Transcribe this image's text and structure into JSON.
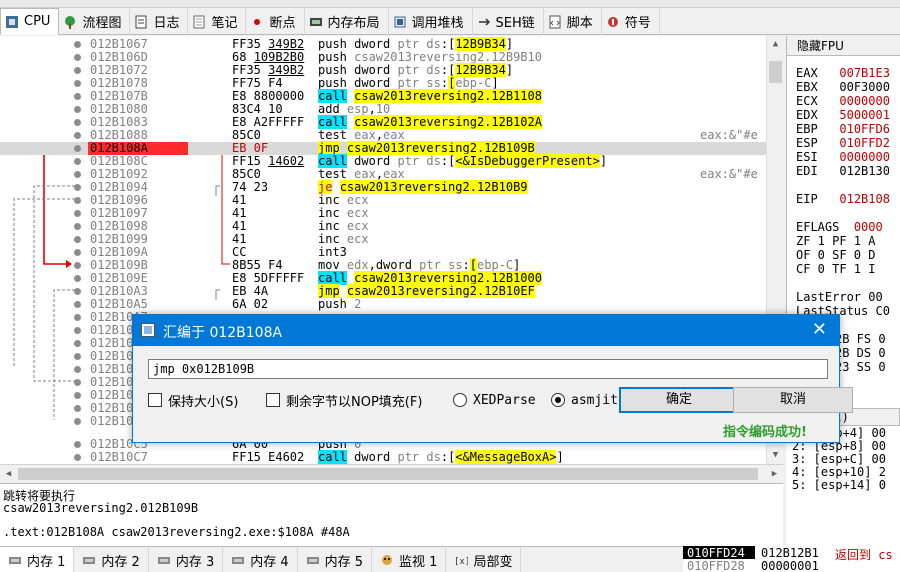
{
  "top_tabs": [
    {
      "label": "CPU",
      "icon": "cpu-icon"
    },
    {
      "label": "流程图",
      "icon": "graph-icon"
    },
    {
      "label": "日志",
      "icon": "log-icon"
    },
    {
      "label": "笔记",
      "icon": "notes-icon"
    },
    {
      "label": "断点",
      "icon": "breakpoint-icon"
    },
    {
      "label": "内存布局",
      "icon": "memory-map-icon"
    },
    {
      "label": "调用堆栈",
      "icon": "callstack-icon"
    },
    {
      "label": "SEH链",
      "icon": "seh-icon"
    },
    {
      "label": "脚本",
      "icon": "script-icon"
    },
    {
      "label": "符号",
      "icon": "symbol-icon"
    }
  ],
  "disasm": [
    {
      "addr": "012B1067",
      "b1": "FF35 ",
      "bu": "349B2",
      "ins": "push dword ptr ds:[12B9B34]",
      "cmt": ""
    },
    {
      "addr": "012B106D",
      "b1": "68 ",
      "bu": "109B2B0",
      "ins": "push csaw2013reversing2.12B9B10",
      "cmt": ""
    },
    {
      "addr": "012B1072",
      "b1": "FF35 ",
      "bu": "349B2",
      "ins": "push dword ptr ds:[12B9B34]",
      "cmt": ""
    },
    {
      "addr": "012B1078",
      "b1": "FF75 F4",
      "bu": "",
      "ins": "push dword ptr ss:[ebp-C]",
      "cmt": ""
    },
    {
      "addr": "012B107B",
      "b1": "E8 8800000",
      "bu": "",
      "ins": "call csaw2013reversing2.12B1108",
      "cmt": ""
    },
    {
      "addr": "012B1080",
      "b1": "83C4 10",
      "bu": "",
      "ins": "add esp,10",
      "cmt": ""
    },
    {
      "addr": "012B1083",
      "b1": "E8 A2FFFFF",
      "bu": "",
      "ins": "call csaw2013reversing2.12B102A",
      "cmt": ""
    },
    {
      "addr": "012B1088",
      "b1": "85C0",
      "bu": "",
      "ins": "test eax,eax",
      "cmt": "eax:&\"#e"
    },
    {
      "addr": "012B108A",
      "b1": "EB 0F",
      "bu": "",
      "ins": "jmp csaw2013reversing2.12B109B",
      "cmt": ""
    },
    {
      "addr": "012B108C",
      "b1": "FF15 ",
      "bu": "14602",
      "ins": "call dword ptr ds:[<&IsDebuggerPresent>]",
      "cmt": ""
    },
    {
      "addr": "012B1092",
      "b1": "85C0",
      "bu": "",
      "ins": "test eax,eax",
      "cmt": "eax:&\"#e"
    },
    {
      "addr": "012B1094",
      "b1": "74 23",
      "bu": "",
      "ins": "je csaw2013reversing2.12B10B9",
      "cmt": ""
    },
    {
      "addr": "012B1096",
      "b1": "41",
      "bu": "",
      "ins": "inc ecx",
      "cmt": ""
    },
    {
      "addr": "012B1097",
      "b1": "41",
      "bu": "",
      "ins": "inc ecx",
      "cmt": ""
    },
    {
      "addr": "012B1098",
      "b1": "41",
      "bu": "",
      "ins": "inc ecx",
      "cmt": ""
    },
    {
      "addr": "012B1099",
      "b1": "41",
      "bu": "",
      "ins": "inc ecx",
      "cmt": ""
    },
    {
      "addr": "012B109A",
      "b1": "CC",
      "bu": "",
      "ins": "int3",
      "cmt": ""
    },
    {
      "addr": "012B109B",
      "b1": "8B55 F4",
      "bu": "",
      "ins": "mov edx,dword ptr ss:[ebp-C]",
      "cmt": ""
    },
    {
      "addr": "012B109E",
      "b1": "E8 5DFFFFF",
      "bu": "",
      "ins": "call csaw2013reversing2.12B1000",
      "cmt": ""
    },
    {
      "addr": "012B10A3",
      "b1": "EB 4A",
      "bu": "",
      "ins": "jmp csaw2013reversing2.12B10EF",
      "cmt": ""
    },
    {
      "addr": "012B10A5",
      "b1": "6A 02",
      "bu": "",
      "ins": "push 2",
      "cmt": ""
    },
    {
      "addr": "012B10A7",
      "b1": "",
      "bu": "",
      "ins": "",
      "cmt": ""
    },
    {
      "addr": "012B10",
      "b1": "",
      "bu": "",
      "ins": "",
      "cmt": ""
    },
    {
      "addr": "012B10",
      "b1": "",
      "bu": "",
      "ins": "",
      "cmt": ""
    },
    {
      "addr": "012B10",
      "b1": "",
      "bu": "",
      "ins": "",
      "cmt": ""
    },
    {
      "addr": "012B10",
      "b1": "",
      "bu": "",
      "ins": "",
      "cmt": ""
    },
    {
      "addr": "012B10",
      "b1": "",
      "bu": "",
      "ins": "",
      "cmt": ""
    },
    {
      "addr": "012B10",
      "b1": "",
      "bu": "",
      "ins": "",
      "cmt": ""
    },
    {
      "addr": "012B10",
      "b1": "",
      "bu": "",
      "ins": "",
      "cmt": ""
    },
    {
      "addr": "012B10",
      "b1": "",
      "bu": "",
      "ins": "",
      "cmt": ""
    },
    {
      "addr": "012B10C5",
      "b1": "6A 00",
      "bu": "",
      "ins": "push 0",
      "cmt": ""
    },
    {
      "addr": "012B10C7",
      "b1": "FF15 E4602",
      "bu": "",
      "ins": "call dword ptr ds:[<&MessageBoxA>]",
      "cmt": ""
    }
  ],
  "info": {
    "line1": "跳转将要执行",
    "line2": "csaw2013reversing2.012B109B",
    "line3": ".text:012B108A csaw2013reversing2.exe:$108A #48A"
  },
  "regs": {
    "header": "隐藏FPU",
    "items": [
      {
        "name": "EAX",
        "val": "007B1E3"
      },
      {
        "name": "EBX",
        "val": "00F3000"
      },
      {
        "name": "ECX",
        "val": "0000000"
      },
      {
        "name": "EDX",
        "val": "5000001"
      },
      {
        "name": "EBP",
        "val": "010FFD6"
      },
      {
        "name": "ESP",
        "val": "010FFD2"
      },
      {
        "name": "ESI",
        "val": "0000000"
      },
      {
        "name": "EDI",
        "val": "012B130"
      }
    ],
    "eip_name": "EIP",
    "eip_val": "012B108",
    "eflags_name": "EFLAGS",
    "eflags_val": "0000",
    "flags1": "ZF 1  PF 1  A",
    "flags2": "OF 0  SF 0  D",
    "flags3": "CF 0  TF 1  I",
    "lasterror": "LastError  00",
    "laststatus": "LastStatus C0",
    "seg1": "2B  FS 0",
    "seg2": "2B  DS 0",
    "seg3": "23  SS 0"
  },
  "stack": {
    "header": "stdcall)",
    "lines": [
      "1: [esp+4] 00",
      "2: [esp+8] 00",
      "3: [esp+C] 00",
      "4: [esp+10] 2",
      "5: [esp+14] 0"
    ]
  },
  "bottom_tabs": [
    "内存 1",
    "内存 2",
    "内存 3",
    "内存 4",
    "内存 5",
    "监视 1",
    "局部变"
  ],
  "dump": {
    "addr1": "010FFD24",
    "addr2": "010FFD28",
    "val1": "012B12B1",
    "val2": "00000001",
    "cmt1": "返回到 cs"
  },
  "dialog": {
    "title": "汇编于 012B108A",
    "input_value": "jmp 0x012B109B",
    "opt_keep_size": "保持大小(S)",
    "opt_fill_nop": "剩余字节以NOP填充(F)",
    "opt_xedparse": "XEDParse",
    "opt_asmjit": "asmjit",
    "ok_label": "确定",
    "cancel_label": "取消",
    "status": "指令编码成功!"
  },
  "colors": {
    "call_bg": "#00e5ff",
    "jmp_bg": "#ffff00",
    "current_addr_bg": "#ff2b2b",
    "accent": "#0078d7",
    "status_ok": "#2f9e2f"
  }
}
